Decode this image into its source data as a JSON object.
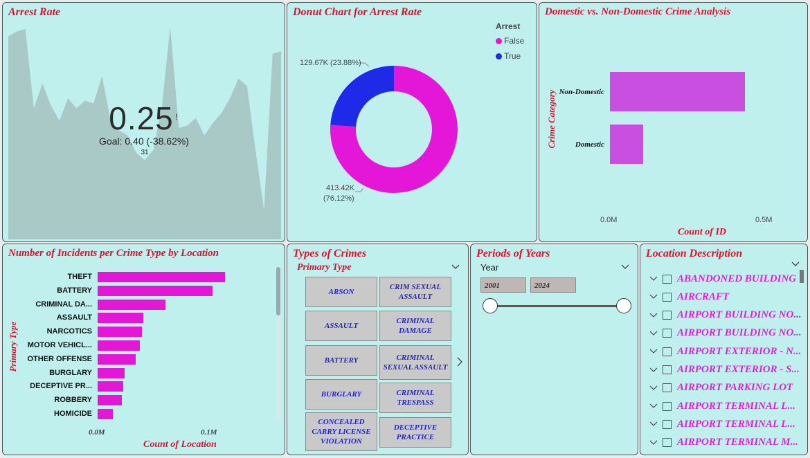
{
  "colors": {
    "panel_bg": "#bff0ee",
    "title_red": "#e0102a",
    "magenta": "#e416d8",
    "blue": "#1f2ae8",
    "purple_bar": "#c84fe0",
    "area_fill": "#a9c9c7",
    "tile_text": "#2323c8"
  },
  "arrest_rate": {
    "title": "Arrest Rate",
    "kpi_value": "0.25",
    "kpi_flag": "!",
    "goal": "Goal: 0.40 (-38.62%)",
    "min_label": "31",
    "trend": [
      0.82,
      0.84,
      0.85,
      0.53,
      0.63,
      0.54,
      0.48,
      0.57,
      0.53,
      0.56,
      0.55,
      0.66,
      0.48,
      0.44,
      0.42,
      0.35,
      0.32,
      0.36,
      0.53,
      0.86,
      0.45,
      0.46,
      0.49,
      0.42,
      0.47,
      0.51,
      0.57,
      0.65,
      0.62,
      0.36,
      0.12,
      0.75,
      0.76
    ]
  },
  "donut": {
    "title": "Donut Chart for Arrest Rate",
    "legend_title": "Arrest",
    "legend": [
      {
        "label": "False",
        "color": "#e416d8"
      },
      {
        "label": "True",
        "color": "#1f2ae8"
      }
    ],
    "label_true": "129.67K (23.88%)",
    "label_false_1": "413.42K",
    "label_false_2": "(76.12%)"
  },
  "domestic": {
    "title": "Domestic vs. Non-Domestic Crime Analysis",
    "ylabel": "Crime Category",
    "xlabel": "Count of ID",
    "ticks": [
      "0.0M",
      "0.5M"
    ]
  },
  "incidents": {
    "title": "Number of Incidents per Crime Type by Location",
    "ylabel": "Primary Type",
    "xlabel": "Count of Location",
    "ticks": [
      "0.0M",
      "0.1M"
    ]
  },
  "chart_data": [
    {
      "type": "area",
      "title": "Arrest Rate",
      "y": [
        0.82,
        0.84,
        0.85,
        0.53,
        0.63,
        0.54,
        0.48,
        0.57,
        0.53,
        0.56,
        0.55,
        0.66,
        0.48,
        0.44,
        0.42,
        0.35,
        0.32,
        0.36,
        0.53,
        0.86,
        0.45,
        0.46,
        0.49,
        0.42,
        0.47,
        0.51,
        0.57,
        0.65,
        0.62,
        0.36,
        0.12,
        0.75,
        0.76
      ]
    },
    {
      "type": "pie",
      "title": "Donut Chart for Arrest Rate",
      "categories": [
        "False",
        "True"
      ],
      "values": [
        413420,
        129670
      ],
      "percent": [
        76.12,
        23.88
      ]
    },
    {
      "type": "bar",
      "title": "Domestic vs. Non-Domestic Crime Analysis",
      "categories": [
        "Non-Domestic",
        "Domestic"
      ],
      "values": [
        435000,
        108000
      ],
      "xlabel": "Count of ID",
      "ylabel": "Crime Category",
      "xlim": [
        0,
        500000
      ]
    },
    {
      "type": "bar",
      "title": "Number of Incidents per Crime Type by Location",
      "categories": [
        "THEFT",
        "BATTERY",
        "CRIMINAL DA...",
        "ASSAULT",
        "NARCOTICS",
        "MOTOR VEHICL...",
        "OTHER OFFENSE",
        "BURGLARY",
        "DECEPTIVE PR...",
        "ROBBERY",
        "HOMICIDE"
      ],
      "values": [
        114000,
        103000,
        61000,
        41000,
        40000,
        38000,
        34000,
        24000,
        23000,
        21500,
        13500
      ],
      "xlabel": "Count of Location",
      "ylabel": "Primary Type",
      "xlim": [
        0,
        100000
      ]
    }
  ],
  "types": {
    "title": "Types of Crimes",
    "subtitle": "Primary Type",
    "tiles_left": [
      "ARSON",
      "ASSAULT",
      "BATTERY",
      "BURGLARY",
      "CONCEALED CARRY LICENSE VIOLATION"
    ],
    "tiles_right": [
      "CRIM SEXUAL ASSAULT",
      "CRIMINAL DAMAGE",
      "CRIMINAL SEXUAL ASSAULT",
      "CRIMINAL TRESPASS",
      "DECEPTIVE PRACTICE"
    ]
  },
  "years": {
    "title": "Periods of Years",
    "label": "Year",
    "start": "2001",
    "end": "2024"
  },
  "locations": {
    "title": "Location Description",
    "items": [
      "ABANDONED BUILDING",
      "AIRCRAFT",
      "AIRPORT BUILDING NO...",
      "AIRPORT BUILDING NO...",
      "AIRPORT EXTERIOR - N...",
      "AIRPORT EXTERIOR - S...",
      "AIRPORT PARKING LOT",
      "AIRPORT TERMINAL L...",
      "AIRPORT TERMINAL L...",
      "AIRPORT TERMINAL M..."
    ]
  }
}
